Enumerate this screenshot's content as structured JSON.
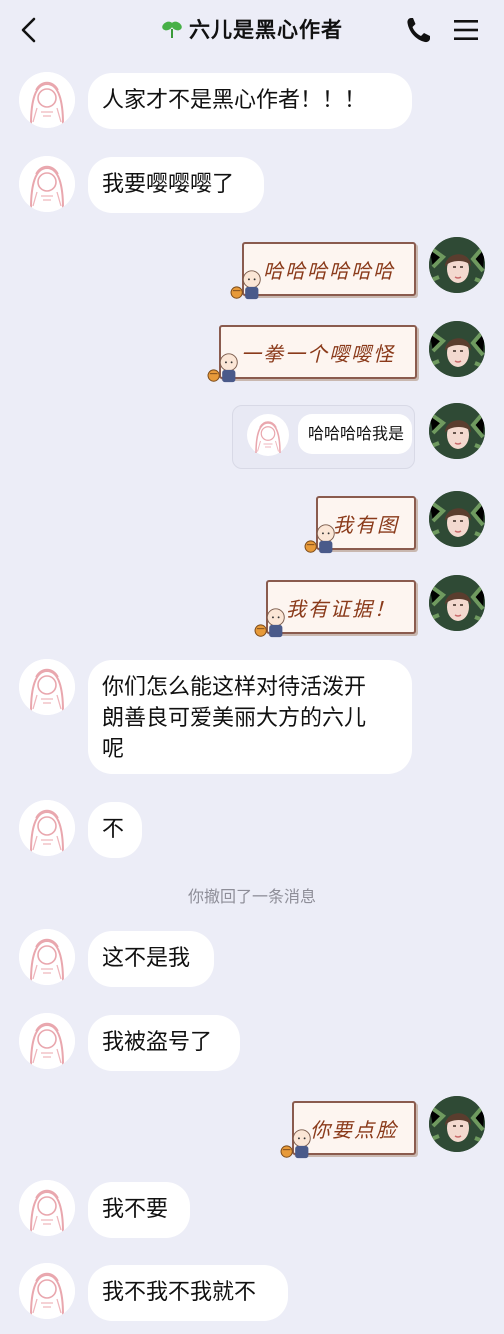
{
  "header": {
    "title": "六儿是黑心作者",
    "icons": {
      "back": "chevron-left-icon",
      "title_prefix": "sprout-icon",
      "call": "phone-icon",
      "menu": "hamburger-menu-icon"
    }
  },
  "messages": [
    {
      "side": "left",
      "type": "text",
      "text": "人家才不是黑心作者！！！"
    },
    {
      "side": "left",
      "type": "text",
      "text": "我要嘤嘤嘤了"
    },
    {
      "side": "right",
      "type": "sticker",
      "text": "哈哈哈哈哈哈"
    },
    {
      "side": "right",
      "type": "sticker",
      "text": "一拳一个嘤嘤怪"
    },
    {
      "side": "right",
      "type": "quote",
      "text": "哈哈哈哈我是"
    },
    {
      "side": "right",
      "type": "sticker",
      "text": "我有图"
    },
    {
      "side": "right",
      "type": "sticker",
      "text": "我有证据！"
    },
    {
      "side": "left",
      "type": "text",
      "lines": [
        "你们怎么能这样对待活泼开",
        "朗善良可爱美丽大方的六儿",
        "呢"
      ]
    },
    {
      "side": "left",
      "type": "text",
      "text": "不"
    },
    {
      "type": "system",
      "text": "你撤回了一条消息"
    },
    {
      "side": "left",
      "type": "text",
      "text": "这不是我"
    },
    {
      "side": "left",
      "type": "text",
      "text": "我被盗号了"
    },
    {
      "side": "right",
      "type": "sticker",
      "text": "你要点脸"
    },
    {
      "side": "left",
      "type": "text",
      "text": "我不要"
    },
    {
      "side": "left",
      "type": "text",
      "text": "我不我不我就不"
    }
  ],
  "colors": {
    "background": "#ecedf7",
    "bubble": "#ffffff",
    "sticker_text": "#8a3a1a",
    "system_text": "#8e8e98"
  }
}
